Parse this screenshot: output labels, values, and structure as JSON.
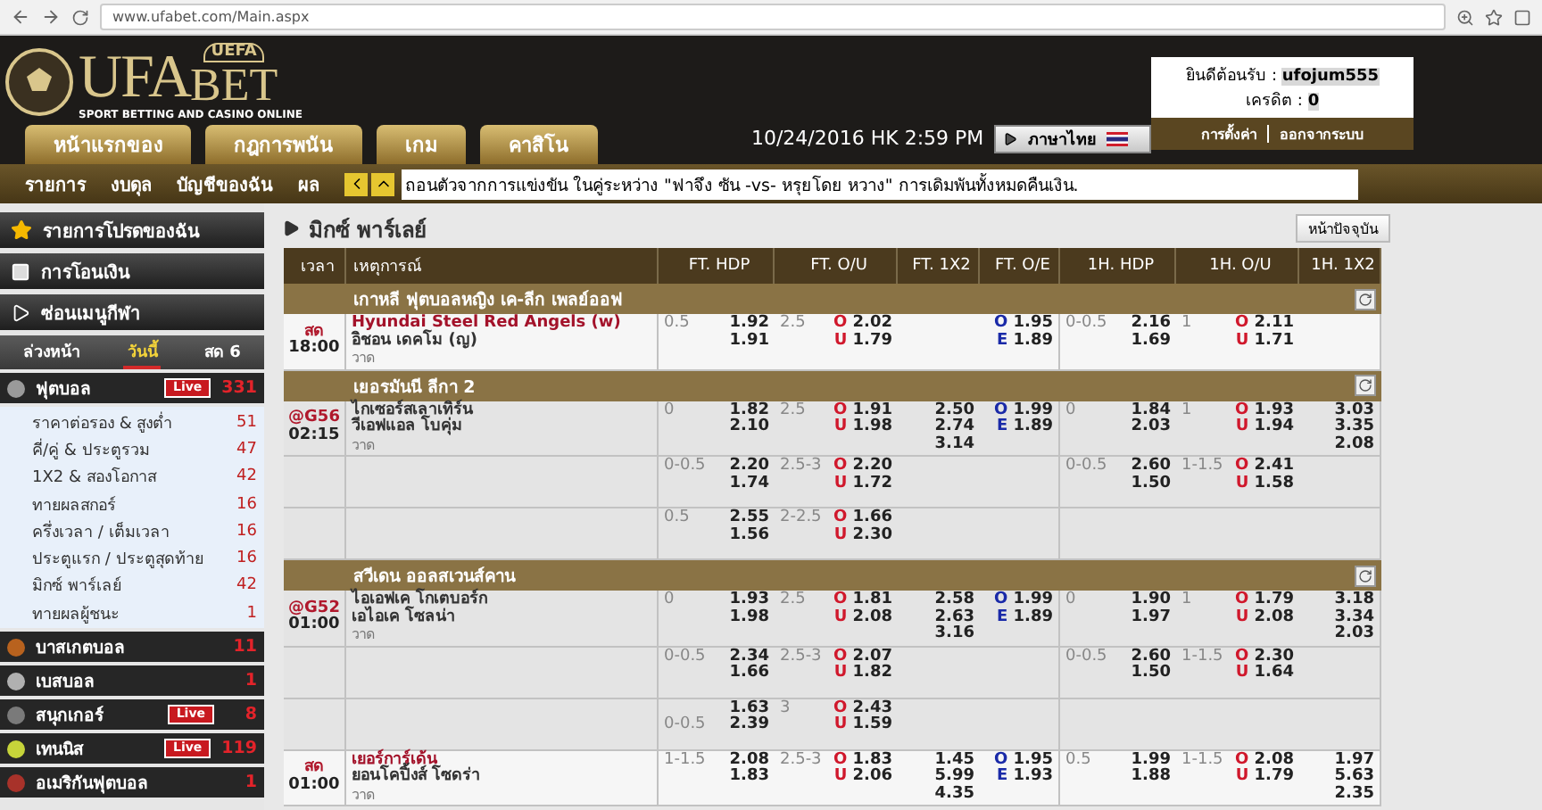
{
  "browser": {
    "url": "www.ufabet.com/Main.aspx"
  },
  "logo": {
    "main": "UFA",
    "second": "BET",
    "badge": "UEFA",
    "tagline": "SPORT BETTING AND CASINO ONLINE"
  },
  "header_tabs": [
    {
      "label": "หน้าแรกของ"
    },
    {
      "label": "กฎการพนัน"
    },
    {
      "label": "เกม"
    },
    {
      "label": "คาสิโน"
    }
  ],
  "datetime": "10/24/2016 HK 2:59 PM",
  "language_button": "ภาษาไทย",
  "user": {
    "welcome_label": "ยินดีต้อนรับ :",
    "username": "ufojum555",
    "credit_label": "เครดิต :",
    "credit": "0",
    "links": [
      "การตั้งค่า",
      "ออกจากระบบ"
    ]
  },
  "nav": {
    "links": [
      "รายการ",
      "งบดุล",
      "บัญชีของฉัน",
      "ผล"
    ],
    "announcement": "ถอนตัวจากการแข่งขัน ในคู่ระหว่าง \"ฟาจึง ซัน -vs- หรุยโดย หวาง\" การเดิมพันทั้งหมดคืนเงิน."
  },
  "sidebar": {
    "menu": [
      {
        "kind": "favorite",
        "label": "รายการโปรดของฉัน"
      },
      {
        "kind": "expand",
        "label": "การโอนเงิน"
      },
      {
        "kind": "collapse",
        "label": "ซ่อนเมนูกีฬา"
      }
    ],
    "tabs": [
      {
        "label": "ล่วงหน้า",
        "selected": false
      },
      {
        "label": "วันนี้",
        "selected": true
      },
      {
        "label": "สด 6",
        "selected": false
      }
    ],
    "sports": [
      {
        "label": "ฟุตบอล",
        "badge": "Live",
        "count": "331",
        "color": "#9a9a9a",
        "children": [
          {
            "label": "ราคาต่อรอง & สูงต่ำ",
            "count": "51"
          },
          {
            "label": "คี่/คู่ & ประตูรวม",
            "count": "47"
          },
          {
            "label": "1X2 & สองโอกาส",
            "count": "42"
          },
          {
            "label": "ทายผลสกอร์",
            "count": "16"
          },
          {
            "label": "ครึ่งเวลา / เต็มเวลา",
            "count": "16"
          },
          {
            "label": "ประตูแรก / ประตูสุดท้าย",
            "count": "16"
          },
          {
            "label": "มิกซ์ พาร์เลย์",
            "count": "42"
          },
          {
            "label": "ทายผลผู้ชนะ",
            "count": "1"
          }
        ]
      },
      {
        "label": "บาสเกตบอล",
        "count": "11",
        "color": "#b8621e"
      },
      {
        "label": "เบสบอล",
        "count": "1",
        "color": "#b0b0b0"
      },
      {
        "label": "สนุกเกอร์",
        "badge": "Live",
        "count": "8",
        "color": "#7a7a7a"
      },
      {
        "label": "เทนนิส",
        "badge": "Live",
        "count": "119",
        "color": "#c6d43a"
      },
      {
        "label": "อเมริกันฟุตบอล",
        "count": "1",
        "color": "#a8322a"
      }
    ]
  },
  "main": {
    "title": "มิกซ์ พาร์เลย์",
    "refresh_button": "หน้าปัจจุบัน"
  },
  "table": {
    "columns": [
      "เวลา",
      "เหตุการณ์",
      "FT. HDP",
      "FT. O/U",
      "FT. 1X2",
      "FT. O/E",
      "1H. HDP",
      "1H. O/U",
      "1H. 1X2"
    ],
    "groups": [
      {
        "league": "เกาหลี ฟุตบอลหญิง เค-ลีก เพลย์ออฟ",
        "rows": [
          {
            "live": true,
            "status": "สด",
            "time": "18:00",
            "home": "Hyundai Steel Red Angels (w)",
            "home_favorite": true,
            "away": "อิชอน เดคโม (ญ)",
            "draw": "วาด",
            "ft_hdp": {
              "line": "0.5",
              "odds": [
                "1.92",
                "1.91"
              ]
            },
            "ft_ou": {
              "line": "2.5",
              "odds": [
                {
                  "label": "O",
                  "value": "2.02"
                },
                {
                  "label": "U",
                  "value": "1.79"
                }
              ]
            },
            "ft_oe": {
              "odds": [
                {
                  "label": "O",
                  "value": "1.95"
                },
                {
                  "label": "E",
                  "value": "1.89"
                }
              ]
            },
            "h1_hdp": {
              "line": "0-0.5",
              "odds": [
                "2.16",
                "1.69"
              ]
            },
            "h1_ou": {
              "line": "1",
              "odds": [
                {
                  "label": "O",
                  "value": "2.11"
                },
                {
                  "label": "U",
                  "value": "1.71"
                }
              ]
            }
          }
        ]
      },
      {
        "league": "เยอรมันนี ลีกา 2",
        "rows": [
          {
            "live": false,
            "status": "@G56",
            "time": "02:15",
            "home": "ไกเซอร์สเลาเทิร์น",
            "home_favorite": false,
            "away": "วีเอฟแอล โบคุ่ม",
            "draw": "วาด",
            "ft_hdp": {
              "line": "0",
              "odds": [
                "1.82",
                "2.10"
              ]
            },
            "ft_ou": {
              "line": "2.5",
              "odds": [
                {
                  "label": "O",
                  "value": "1.91"
                },
                {
                  "label": "U",
                  "value": "1.98"
                }
              ]
            },
            "ft_1x2": [
              "2.50",
              "2.74",
              "3.14"
            ],
            "ft_oe": {
              "odds": [
                {
                  "label": "O",
                  "value": "1.99"
                },
                {
                  "label": "E",
                  "value": "1.89"
                }
              ]
            },
            "h1_hdp": {
              "line": "0",
              "odds": [
                "1.84",
                "2.03"
              ]
            },
            "h1_ou": {
              "line": "1",
              "odds": [
                {
                  "label": "O",
                  "value": "1.93"
                },
                {
                  "label": "U",
                  "value": "1.94"
                }
              ]
            },
            "h1_1x2": [
              "3.03",
              "3.35",
              "2.08"
            ]
          },
          {
            "live": false,
            "ft_hdp": {
              "line": "0-0.5",
              "odds": [
                "2.20",
                "1.74"
              ]
            },
            "ft_ou": {
              "line": "2.5-3",
              "odds": [
                {
                  "label": "O",
                  "value": "2.20"
                },
                {
                  "label": "U",
                  "value": "1.72"
                }
              ]
            },
            "h1_hdp": {
              "line": "0-0.5",
              "odds": [
                "2.60",
                "1.50"
              ]
            },
            "h1_ou": {
              "line": "1-1.5",
              "odds": [
                {
                  "label": "O",
                  "value": "2.41"
                },
                {
                  "label": "U",
                  "value": "1.58"
                }
              ]
            }
          },
          {
            "live": false,
            "ft_hdp": {
              "line": "0.5",
              "odds": [
                "2.55",
                "1.56"
              ]
            },
            "ft_ou": {
              "line": "2-2.5",
              "odds": [
                {
                  "label": "O",
                  "value": "1.66"
                },
                {
                  "label": "U",
                  "value": "2.30"
                }
              ]
            }
          }
        ]
      },
      {
        "league": "สวีเดน ออลสเวนส์คาน",
        "rows": [
          {
            "live": false,
            "status": "@G52",
            "time": "01:00",
            "home": "ไอเอฟเค โกเตบอร์ก",
            "home_favorite": false,
            "away": "เอไอเค โซลน่า",
            "draw": "วาด",
            "ft_hdp": {
              "line": "0",
              "odds": [
                "1.93",
                "1.98"
              ]
            },
            "ft_ou": {
              "line": "2.5",
              "odds": [
                {
                  "label": "O",
                  "value": "1.81"
                },
                {
                  "label": "U",
                  "value": "2.08"
                }
              ]
            },
            "ft_1x2": [
              "2.58",
              "2.63",
              "3.16"
            ],
            "ft_oe": {
              "odds": [
                {
                  "label": "O",
                  "value": "1.99"
                },
                {
                  "label": "E",
                  "value": "1.89"
                }
              ]
            },
            "h1_hdp": {
              "line": "0",
              "odds": [
                "1.90",
                "1.97"
              ]
            },
            "h1_ou": {
              "line": "1",
              "odds": [
                {
                  "label": "O",
                  "value": "1.79"
                },
                {
                  "label": "U",
                  "value": "2.08"
                }
              ]
            },
            "h1_1x2": [
              "3.18",
              "3.34",
              "2.03"
            ]
          },
          {
            "live": false,
            "ft_hdp": {
              "line": "0-0.5",
              "odds": [
                "2.34",
                "1.66"
              ]
            },
            "ft_ou": {
              "line": "2.5-3",
              "odds": [
                {
                  "label": "O",
                  "value": "2.07"
                },
                {
                  "label": "U",
                  "value": "1.82"
                }
              ]
            },
            "h1_hdp": {
              "line": "0-0.5",
              "odds": [
                "2.60",
                "1.50"
              ]
            },
            "h1_ou": {
              "line": "1-1.5",
              "odds": [
                {
                  "label": "O",
                  "value": "2.30"
                },
                {
                  "label": "U",
                  "value": "1.64"
                }
              ]
            }
          },
          {
            "live": false,
            "ft_hdp": {
              "line": "0-0.5",
              "away_line": true,
              "odds": [
                "1.63",
                "2.39"
              ]
            },
            "ft_ou": {
              "line": "3",
              "odds": [
                {
                  "label": "O",
                  "value": "2.43"
                },
                {
                  "label": "U",
                  "value": "1.59"
                }
              ]
            }
          },
          {
            "live": true,
            "status": "สด",
            "time": "01:00",
            "home": "เยอร์การ์เด้น",
            "home_favorite": true,
            "away": "ยอนโคปิ้งส์ โซดร่า",
            "draw": "วาด",
            "ft_hdp": {
              "line": "1-1.5",
              "odds": [
                "2.08",
                "1.83"
              ]
            },
            "ft_ou": {
              "line": "2.5-3",
              "odds": [
                {
                  "label": "O",
                  "value": "1.83"
                },
                {
                  "label": "U",
                  "value": "2.06"
                }
              ]
            },
            "ft_1x2": [
              "1.45",
              "5.99",
              "4.35"
            ],
            "ft_oe": {
              "odds": [
                {
                  "label": "O",
                  "value": "1.95"
                },
                {
                  "label": "E",
                  "value": "1.93"
                }
              ]
            },
            "h1_hdp": {
              "line": "0.5",
              "odds": [
                "1.99",
                "1.88"
              ]
            },
            "h1_ou": {
              "line": "1-1.5",
              "odds": [
                {
                  "label": "O",
                  "value": "2.08"
                },
                {
                  "label": "U",
                  "value": "1.79"
                }
              ]
            },
            "h1_1x2": [
              "1.97",
              "5.63",
              "2.35"
            ]
          }
        ]
      }
    ]
  }
}
